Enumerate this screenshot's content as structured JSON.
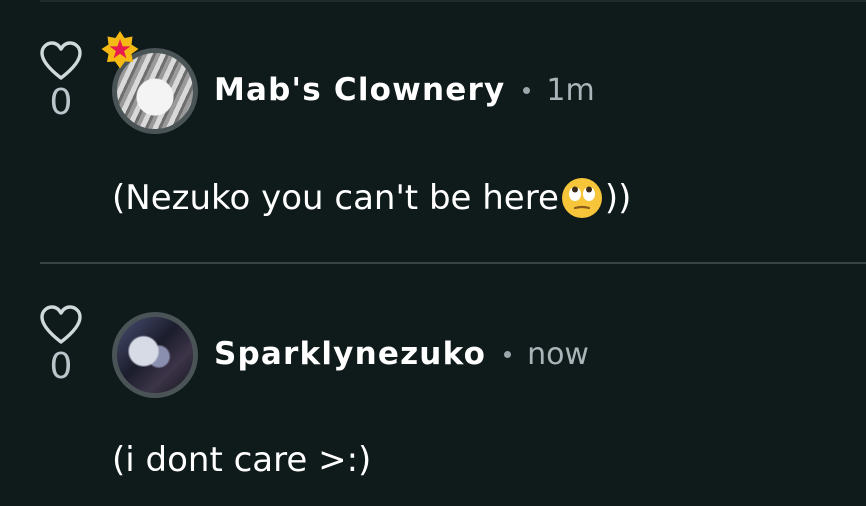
{
  "comments": [
    {
      "likes": "0",
      "author": "Mab's Clownery",
      "time": "1m",
      "body_before": "(Nezuko you can't be here",
      "emoji": "face-with-rolling-eyes",
      "body_after": "))",
      "has_badge": true
    },
    {
      "likes": "0",
      "author": "Sparklynezuko",
      "time": "now",
      "body_before": "(i dont care >:)",
      "emoji": "",
      "body_after": "",
      "has_badge": false
    }
  ],
  "colors": {
    "background": "#0f1a1b",
    "badge": "#f5b914",
    "badge_star": "#e8194d",
    "divider": "#3a4446"
  }
}
